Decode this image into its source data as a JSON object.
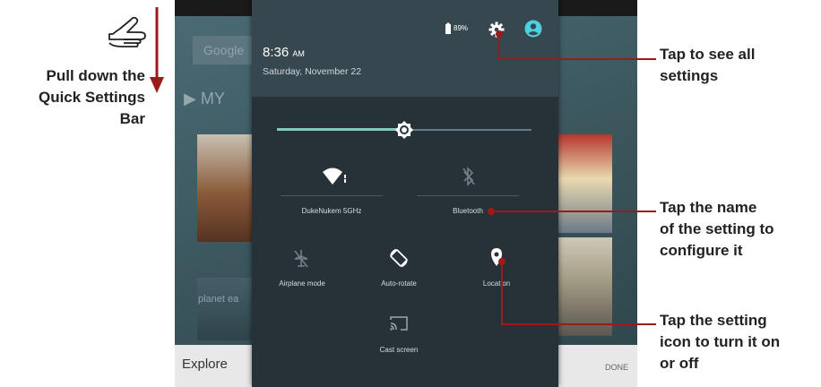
{
  "left_annotation": {
    "text": "Pull down the\nQuick Settings\nBar"
  },
  "background": {
    "google_text": "Google",
    "play_text": "MY",
    "planet_text": "planet ea",
    "explore_text": "Explore",
    "done_text": "DONE"
  },
  "panel": {
    "time": "8:36",
    "time_suffix": "AM",
    "date": "Saturday, November 22",
    "battery": "89%",
    "brightness_level": 0.5,
    "tiles": {
      "wifi": "DukeNukem 5GHz",
      "bluetooth": "Bluetooth",
      "airplane": "Airplane mode",
      "rotate": "Auto-rotate",
      "location": "Location",
      "cast": "Cast screen"
    }
  },
  "callouts": {
    "settings": "Tap to see all\nsettings",
    "name": "Tap the name\nof the setting to\nconfigure it",
    "icon": "Tap the setting\nicon to turn it on\nor off"
  },
  "colors": {
    "accent_red": "#9b1b1b",
    "panel_bg": "#263238",
    "header_bg": "#37474f",
    "slider_accent": "#80cbc4",
    "avatar_teal": "#4dd0e1"
  },
  "icons": [
    "pointing-hand-icon",
    "down-arrow-icon",
    "battery-icon",
    "gear-icon",
    "account-icon",
    "brightness-icon",
    "wifi-icon",
    "bluetooth-icon",
    "airplane-icon",
    "auto-rotate-icon",
    "location-pin-icon",
    "cast-icon"
  ]
}
